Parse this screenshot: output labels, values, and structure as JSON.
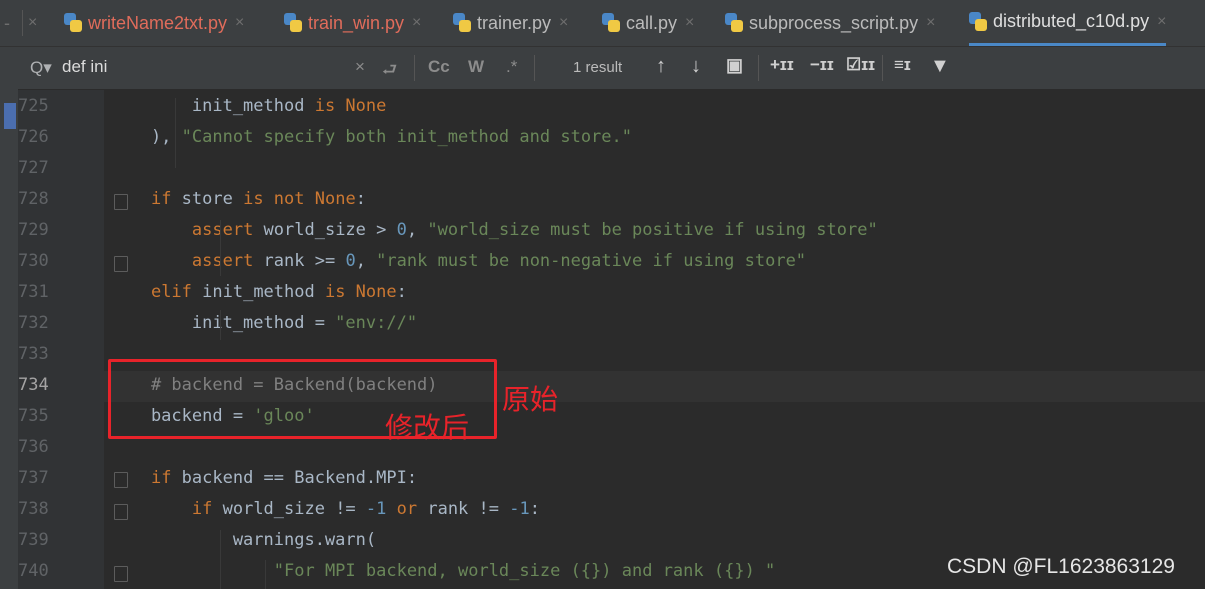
{
  "tabs": [
    {
      "label": "writeName2txt.py",
      "state": "modified"
    },
    {
      "label": "train_win.py",
      "state": "modified"
    },
    {
      "label": "trainer.py",
      "state": "normal"
    },
    {
      "label": "call.py",
      "state": "normal"
    },
    {
      "label": "subprocess_script.py",
      "state": "normal"
    },
    {
      "label": "distributed_c10d.py",
      "state": "active"
    }
  ],
  "search": {
    "query": "def ini",
    "result": "1 result",
    "icons": [
      "search-icon",
      "clear-icon",
      "newline-icon",
      "match-case-icon",
      "words-icon",
      "regex-icon",
      "prev-occurrence-icon",
      "next-occurrence-icon",
      "select-all-icon",
      "add-selection-icon",
      "remove-selection-icon",
      "select-all-occurrences-icon",
      "multiline-icon",
      "filter-icon"
    ]
  },
  "editor": {
    "line_numbers": [
      "725",
      "726",
      "727",
      "728",
      "729",
      "730",
      "731",
      "732",
      "733",
      "734",
      "735",
      "736",
      "737",
      "738",
      "739",
      "740"
    ],
    "current_line": "734",
    "lines": [
      [
        {
          "t": "        init_method ",
          "c": "plain"
        },
        {
          "t": "is None",
          "c": "kw"
        }
      ],
      [
        {
          "t": "    ), ",
          "c": "plain"
        },
        {
          "t": "\"Cannot specify both init_method and store.\"",
          "c": "str"
        }
      ],
      [],
      [
        {
          "t": "    ",
          "c": "plain"
        },
        {
          "t": "if ",
          "c": "kw"
        },
        {
          "t": "store ",
          "c": "plain"
        },
        {
          "t": "is not None",
          "c": "kw"
        },
        {
          "t": ":",
          "c": "plain"
        }
      ],
      [
        {
          "t": "        ",
          "c": "plain"
        },
        {
          "t": "assert ",
          "c": "kw"
        },
        {
          "t": "world_size > ",
          "c": "plain"
        },
        {
          "t": "0",
          "c": "num"
        },
        {
          "t": ", ",
          "c": "plain"
        },
        {
          "t": "\"world_size must be positive if using store\"",
          "c": "str"
        }
      ],
      [
        {
          "t": "        ",
          "c": "plain"
        },
        {
          "t": "assert ",
          "c": "kw"
        },
        {
          "t": "rank >= ",
          "c": "plain"
        },
        {
          "t": "0",
          "c": "num"
        },
        {
          "t": ", ",
          "c": "plain"
        },
        {
          "t": "\"rank must be non-negative if using store\"",
          "c": "str"
        }
      ],
      [
        {
          "t": "    ",
          "c": "plain"
        },
        {
          "t": "elif ",
          "c": "kw"
        },
        {
          "t": "init_method ",
          "c": "plain"
        },
        {
          "t": "is None",
          "c": "kw"
        },
        {
          "t": ":",
          "c": "plain"
        }
      ],
      [
        {
          "t": "        init_method = ",
          "c": "plain"
        },
        {
          "t": "\"env://\"",
          "c": "str"
        }
      ],
      [],
      [
        {
          "t": "    # backend = Backend(backend)",
          "c": "cmt"
        }
      ],
      [
        {
          "t": "    backend = ",
          "c": "plain"
        },
        {
          "t": "'gloo'",
          "c": "str"
        }
      ],
      [],
      [
        {
          "t": "    ",
          "c": "plain"
        },
        {
          "t": "if ",
          "c": "kw"
        },
        {
          "t": "backend == Backend.MPI:",
          "c": "plain"
        }
      ],
      [
        {
          "t": "        ",
          "c": "plain"
        },
        {
          "t": "if ",
          "c": "kw"
        },
        {
          "t": "world_size != ",
          "c": "plain"
        },
        {
          "t": "-1 ",
          "c": "num"
        },
        {
          "t": "or ",
          "c": "kw"
        },
        {
          "t": "rank != ",
          "c": "plain"
        },
        {
          "t": "-1",
          "c": "num"
        },
        {
          "t": ":",
          "c": "plain"
        }
      ],
      [
        {
          "t": "            warnings.warn(",
          "c": "plain"
        }
      ],
      [
        {
          "t": "                ",
          "c": "plain"
        },
        {
          "t": "\"For MPI backend, world_size ({}) and rank ({}) \"",
          "c": "str"
        }
      ]
    ]
  },
  "annotation": {
    "original_label": "原始",
    "modified_label": "修改后"
  },
  "watermark": "CSDN @FL1623863129",
  "colors": {
    "annotation": "#e8232a",
    "keyword": "#cc7832",
    "string": "#6a8759",
    "number": "#6897bb",
    "comment": "#808080",
    "active_tab_underline": "#4a88c7"
  }
}
